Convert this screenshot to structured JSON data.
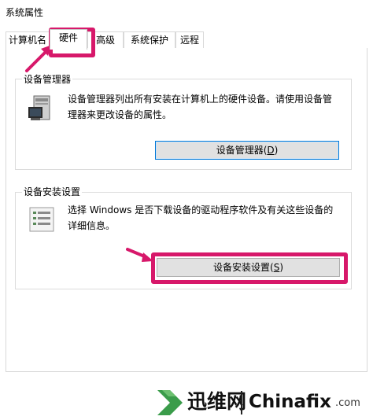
{
  "window": {
    "title": "系统属性"
  },
  "tabs": [
    {
      "label": "计算机名",
      "selected": false
    },
    {
      "label": "硬件",
      "selected": true
    },
    {
      "label": "高级",
      "selected": false
    },
    {
      "label": "系统保护",
      "selected": false
    },
    {
      "label": "远程",
      "selected": false
    }
  ],
  "device_manager": {
    "group_title": "设备管理器",
    "description_line1": "设备管理器列出所有安装在计算机上的硬件设备。请使用设备管",
    "description_line2": "理器来更改设备的属性。",
    "button_label": "设备管理器(",
    "button_mnemonic": "D",
    "button_close": ")"
  },
  "device_install": {
    "group_title": "设备安装设置",
    "description_line1": "选择 Windows 是否下载设备的驱动程序软件及有关这些设备的",
    "description_line2": "详细信息。",
    "button_label": "设备安装设置(",
    "button_mnemonic": "S",
    "button_close": ")"
  },
  "highlight_color": "#d7186a",
  "watermark": {
    "cn": "迅维网",
    "en": "Chinafix",
    "suffix": ".com"
  }
}
